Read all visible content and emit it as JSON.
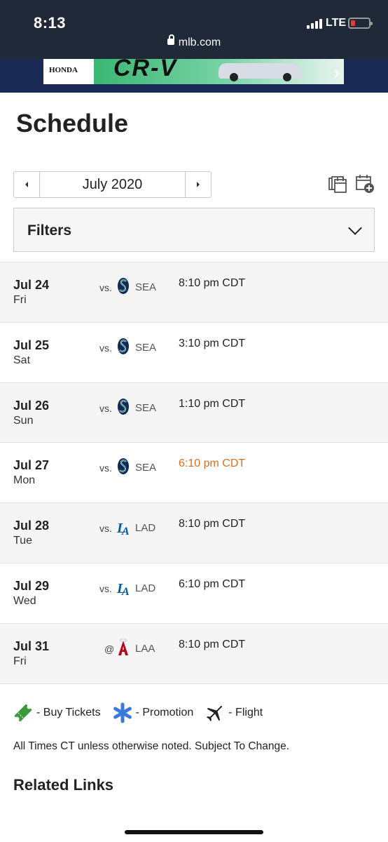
{
  "status_bar": {
    "time": "8:13",
    "network": "LTE"
  },
  "browser": {
    "url": "mlb.com"
  },
  "ad": {
    "brand": "HONDA",
    "model": "CR-V"
  },
  "page": {
    "title": "Schedule"
  },
  "month_picker": {
    "label": "July 2020",
    "prev_icon": "caret-left-icon",
    "next_icon": "caret-right-icon"
  },
  "toolbar_icons": [
    "calendar-stack-icon",
    "calendar-add-icon"
  ],
  "filters": {
    "label": "Filters"
  },
  "games": [
    {
      "date": "Jul 24",
      "day": "Fri",
      "prefix": "vs.",
      "team": "SEA",
      "time": "8:10 pm CDT",
      "highlight": false
    },
    {
      "date": "Jul 25",
      "day": "Sat",
      "prefix": "vs.",
      "team": "SEA",
      "time": "3:10 pm CDT",
      "highlight": false
    },
    {
      "date": "Jul 26",
      "day": "Sun",
      "prefix": "vs.",
      "team": "SEA",
      "time": "1:10 pm CDT",
      "highlight": false
    },
    {
      "date": "Jul 27",
      "day": "Mon",
      "prefix": "vs.",
      "team": "SEA",
      "time": "6:10 pm CDT",
      "highlight": true
    },
    {
      "date": "Jul 28",
      "day": "Tue",
      "prefix": "vs.",
      "team": "LAD",
      "time": "8:10 pm CDT",
      "highlight": false
    },
    {
      "date": "Jul 29",
      "day": "Wed",
      "prefix": "vs.",
      "team": "LAD",
      "time": "6:10 pm CDT",
      "highlight": false
    },
    {
      "date": "Jul 31",
      "day": "Fri",
      "prefix": "@",
      "team": "LAA",
      "time": "8:10 pm CDT",
      "highlight": false
    }
  ],
  "colors": {
    "highlight_time": "#d9701f",
    "tickets": "#3a9a3a",
    "promotion": "#3a7bd5"
  },
  "legend": {
    "tickets": "- Buy Tickets",
    "promotion": "- Promotion",
    "flight": "- Flight"
  },
  "note": "All Times CT unless otherwise noted. Subject To Change.",
  "related_links": {
    "title": "Related Links"
  }
}
